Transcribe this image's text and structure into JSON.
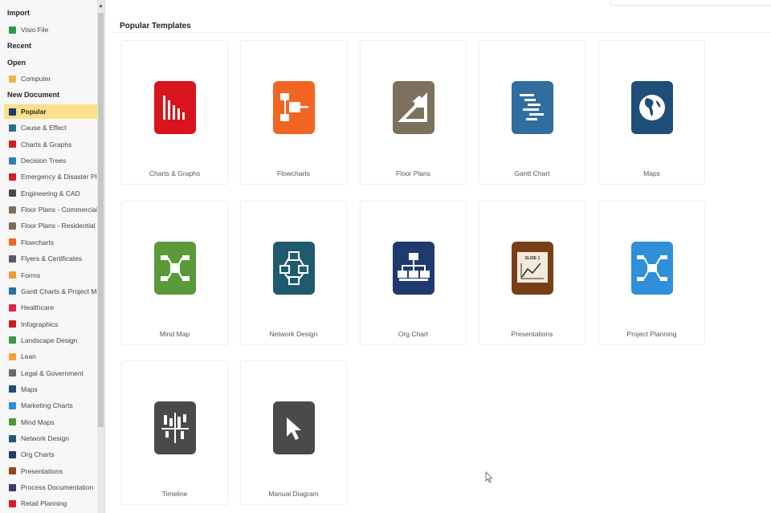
{
  "sidebar": {
    "sections": {
      "import": "Import",
      "recent": "Recent",
      "open": "Open",
      "new_document": "New Document"
    },
    "import_items": [
      {
        "label": "Visio File",
        "icon": "visio-icon",
        "color": "#2e9a48"
      }
    ],
    "open_items": [
      {
        "label": "Computer",
        "icon": "folder-icon",
        "color": "#e7b94a"
      }
    ],
    "new_items": [
      {
        "label": "Popular",
        "icon": "star-icon",
        "color": "#1f3a6e",
        "active": true
      },
      {
        "label": "Cause & Effect",
        "icon": "cause-effect-icon",
        "color": "#2f6e8c"
      },
      {
        "label": "Charts & Graphs",
        "icon": "bar-chart-icon",
        "color": "#d51d26"
      },
      {
        "label": "Decision Trees",
        "icon": "decision-tree-icon",
        "color": "#2f7fb8"
      },
      {
        "label": "Emergency & Disaster Pla...",
        "icon": "emergency-icon",
        "color": "#d51d26"
      },
      {
        "label": "Engineering & CAD",
        "icon": "engineering-icon",
        "color": "#4a4a4a"
      },
      {
        "label": "Floor Plans - Commercial",
        "icon": "floor-plan-commercial-icon",
        "color": "#7a6e5a"
      },
      {
        "label": "Floor Plans - Residential",
        "icon": "floor-plan-residential-icon",
        "color": "#7a6e5a"
      },
      {
        "label": "Flowcharts",
        "icon": "flowchart-icon",
        "color": "#f26522"
      },
      {
        "label": "Flyers & Certificates",
        "icon": "flyer-icon",
        "color": "#5a5a5a"
      },
      {
        "label": "Forms",
        "icon": "forms-icon",
        "color": "#f29a2e"
      },
      {
        "label": "Gantt Charts & Project Mgt",
        "icon": "gantt-icon",
        "color": "#2f6e9e"
      },
      {
        "label": "Healthcare",
        "icon": "healthcare-icon",
        "color": "#d8234f"
      },
      {
        "label": "Infographics",
        "icon": "infographics-icon",
        "color": "#c81e1e"
      },
      {
        "label": "Landscape Design",
        "icon": "landscape-icon",
        "color": "#3a9a4a"
      },
      {
        "label": "Lean",
        "icon": "lean-icon",
        "color": "#f2a23a"
      },
      {
        "label": "Legal & Government",
        "icon": "legal-icon",
        "color": "#6a6a6a"
      },
      {
        "label": "Maps",
        "icon": "globe-icon",
        "color": "#1f4e79"
      },
      {
        "label": "Marketing Charts",
        "icon": "marketing-icon",
        "color": "#2f8fd8"
      },
      {
        "label": "Mind Maps",
        "icon": "mind-map-icon",
        "color": "#4a9a3a"
      },
      {
        "label": "Network Design",
        "icon": "network-icon",
        "color": "#1f5a6e"
      },
      {
        "label": "Org Charts",
        "icon": "org-chart-icon",
        "color": "#1f3a6e"
      },
      {
        "label": "Presentations",
        "icon": "presentation-icon",
        "color": "#8a4a1f"
      },
      {
        "label": "Process Documentation",
        "icon": "process-icon",
        "color": "#3a3a6e"
      },
      {
        "label": "Retail Planning",
        "icon": "retail-icon",
        "color": "#d51d26"
      }
    ]
  },
  "main": {
    "title": "Popular Templates",
    "templates": [
      {
        "label": "Charts & Graphs",
        "icon": "bar-chart-icon",
        "color": "#d8141c"
      },
      {
        "label": "Flowcharts",
        "icon": "flowchart-icon",
        "color": "#f26522"
      },
      {
        "label": "Floor Plans",
        "icon": "floor-plan-icon",
        "color": "#7d705c"
      },
      {
        "label": "Gantt Chart",
        "icon": "gantt-icon",
        "color": "#2f6e9e"
      },
      {
        "label": "Maps",
        "icon": "globe-icon",
        "color": "#1f4e79"
      },
      {
        "label": "Mind Map",
        "icon": "mind-map-icon",
        "color": "#5a9a3a"
      },
      {
        "label": "Network Design",
        "icon": "network-icon",
        "color": "#1f5a6e"
      },
      {
        "label": "Org Chart",
        "icon": "org-chart-icon",
        "color": "#1f3a6e"
      },
      {
        "label": "Presentations",
        "icon": "presentation-icon",
        "color": "#7a3e16",
        "badge": "SLIDE 1"
      },
      {
        "label": "Project Planning",
        "icon": "project-planning-icon",
        "color": "#2f8fd8"
      },
      {
        "label": "Timeline",
        "icon": "timeline-icon",
        "color": "#4a4a4a"
      },
      {
        "label": "Manual Diagram",
        "icon": "cursor-arrow-icon",
        "color": "#4a4a4a"
      }
    ]
  }
}
